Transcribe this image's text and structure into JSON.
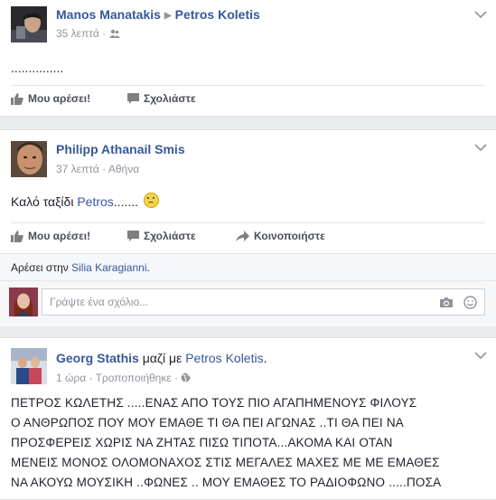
{
  "post1": {
    "author": "Manos Manatakis",
    "target": "Petros Koletis",
    "time": "35 λεπτά",
    "audience_icon": "friends-icon",
    "body": "...............",
    "like_label": "Μου αρέσει!",
    "comment_label": "Σχολιάστε"
  },
  "post2": {
    "author": "Philipp Athanail Smis",
    "time": "37 λεπτά",
    "location": "Αθήνα",
    "body_prefix": "Καλό ταξίδι",
    "body_link": "Petros",
    "body_suffix": ".......",
    "emoji": "☹",
    "like_label": "Μου αρέσει!",
    "comment_label": "Σχολιάστε",
    "share_label": "Κοινοποιήστε",
    "likes_prefix": "Αρέσει στην",
    "likes_name": "Silia Karagianni",
    "likes_suffix": ".",
    "comment_placeholder": "Γράψτε ένα σχόλιο..."
  },
  "post3": {
    "author": "Georg Stathis",
    "with_text": "μαζί με",
    "tagged": "Petros Koletis",
    "tagged_suffix": ".",
    "time": "1 ώρα",
    "edited": "Τροποποιήθηκε",
    "lines": [
      "ΠΕΤΡΟΣ ΚΩΛΕΤΗΣ .....ΕΝΑΣ ΑΠΟ ΤΟΥΣ ΠΙΟ ΑΓΑΠΗΜΕΝΟΥΣ ΦΙΛΟΥΣ",
      "Ο ΑΝΘΡΩΠΟΣ ΠΟΥ ΜΟΥ ΕΜΑΘΕ ΤΙ ΘΑ ΠΕΙ ΑΓΩΝΑΣ ..ΤΙ ΘΑ ΠΕΙ ΝΑ",
      "ΠΡΟΣΦΕΡΕΙΣ ΧΩΡΙΣ ΝΑ ΖΗΤΑΣ ΠΙΣΩ ΤΙΠΟΤΑ...ΑΚΟΜΑ ΚΑΙ ΟΤΑΝ",
      "ΜΕΝΕΙΣ ΜΟΝΟΣ ΟΛΟΜΟΝΑΧΟΣ ΣΤΙΣ ΜΕΓΑΛΕΣ ΜΑΧΕΣ ΜΕ ΜΕ ΕΜΑΘΕΣ",
      "ΝΑ ΑΚΟΥΩ ΜΟΥΣΙΚΗ ..ΦΩΝΕΣ .. ΜΟΥ ΕΜΑΘΕΣ ΤΟ ΡΑΔΙΟΦΩΝΟ .....ΠΟΣΑ"
    ]
  },
  "colors": {
    "link": "#365899",
    "meta": "#90949c",
    "background": "#e9ebee"
  }
}
